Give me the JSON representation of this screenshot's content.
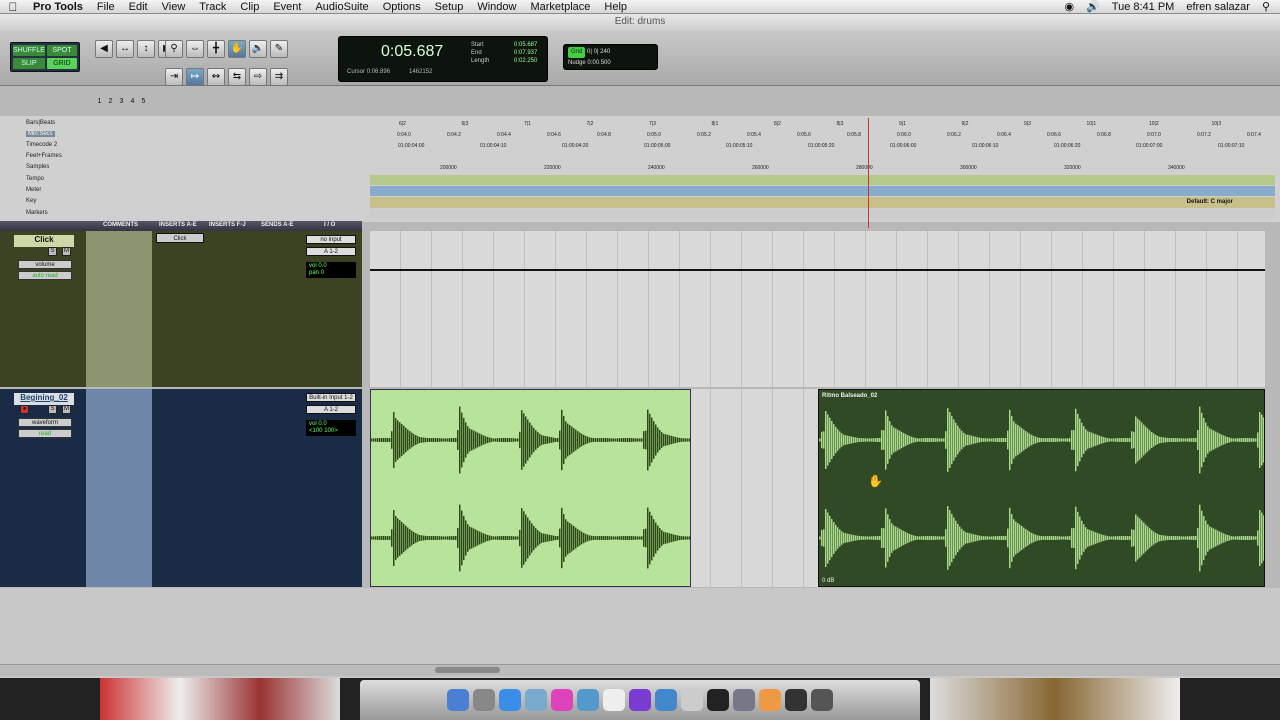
{
  "menubar": {
    "app": "Pro Tools",
    "items": [
      "File",
      "Edit",
      "View",
      "Track",
      "Clip",
      "Event",
      "AudioSuite",
      "Options",
      "Setup",
      "Window",
      "Marketplace",
      "Help"
    ],
    "clock": "Tue 8:41 PM",
    "user": "efren salazar"
  },
  "window": {
    "title": "Edit: drums"
  },
  "toolbar": {
    "modes": [
      "SHUFFLE",
      "SPOT",
      "SLIP",
      "GRID"
    ],
    "zoom_presets": [
      "1",
      "2",
      "3",
      "4",
      "5"
    ],
    "counter_main": "0:05.687",
    "cursor_label": "Cursor",
    "cursor_value": "0:06.896",
    "samples_value": "1462152",
    "start_label": "Start",
    "end_label": "End",
    "length_label": "Length",
    "start_value": "0:05.687",
    "end_value": "0:07.937",
    "length_value": "0:02.250",
    "grid_label": "Grid",
    "grid_value": "0| 0| 240",
    "nudge_label": "Nudge",
    "nudge_value": "0:00.500"
  },
  "rulers": {
    "labels": [
      "Bars|Beats",
      "Min:Secs",
      "Timecode 2",
      "Feet+Frames",
      "Samples",
      "Tempo",
      "Meter",
      "Key",
      "Markers"
    ],
    "bars": [
      "6|2",
      "6|3",
      "7|1",
      "7|2",
      "7|3",
      "8|1",
      "8|2",
      "8|3",
      "9|1",
      "9|2",
      "9|3",
      "10|1",
      "10|2",
      "10|3"
    ],
    "minsecs": [
      "0:04.0",
      "0:04.2",
      "0:04.4",
      "0:04.6",
      "0:04.8",
      "0:05.0",
      "0:05.2",
      "0:05.4",
      "0:05.6",
      "0:05.8",
      "0:06.0",
      "0:06.2",
      "0:06.4",
      "0:06.6",
      "0:06.8",
      "0:07.0",
      "0:07.2",
      "0:07.4"
    ],
    "timecode": [
      "01:00:04:00",
      "01:00:04:10",
      "01:00:04:20",
      "01:00:05:00",
      "01:00:05:10",
      "01:00:05:20",
      "01:00:06:00",
      "01:00:06:10",
      "01:00:06:20",
      "01:00:07:00",
      "01:00:07:10"
    ],
    "samples": [
      "200000",
      "220000",
      "240000",
      "260000",
      "280000",
      "300000",
      "320000",
      "340000"
    ],
    "key_value": "Default: C major"
  },
  "columns": [
    "COMMENTS",
    "INSERTS A-E",
    "INSERTS F-J",
    "SENDS A-E",
    "I / O"
  ],
  "tracks": [
    {
      "name": "Click",
      "view": "volume",
      "mode": "auto read",
      "insert": "Click",
      "io_in": "no input",
      "io_out": "A 1-2",
      "vol_label": "vol",
      "vol": "0.0",
      "pan_label": "pan",
      "pan": "0"
    },
    {
      "name": "Begining_02",
      "view": "waveform",
      "mode": "read",
      "io_in": "Built-in Input 1-2",
      "io_out": "A 1-2",
      "vol_label": "vol",
      "vol": "0.0",
      "pan_l": "<100",
      "pan_r": "100>"
    }
  ],
  "clips": {
    "clip_b_name": "Ritmo Balseado_02",
    "clip_b_db": "0 dB"
  },
  "dock_icons": [
    "finder",
    "launchpad",
    "safari",
    "photos",
    "itunes",
    "mail",
    "calendar",
    "protools",
    "quicktime",
    "preview",
    "dashboard",
    "system",
    "music",
    "logic",
    "keyboard"
  ]
}
